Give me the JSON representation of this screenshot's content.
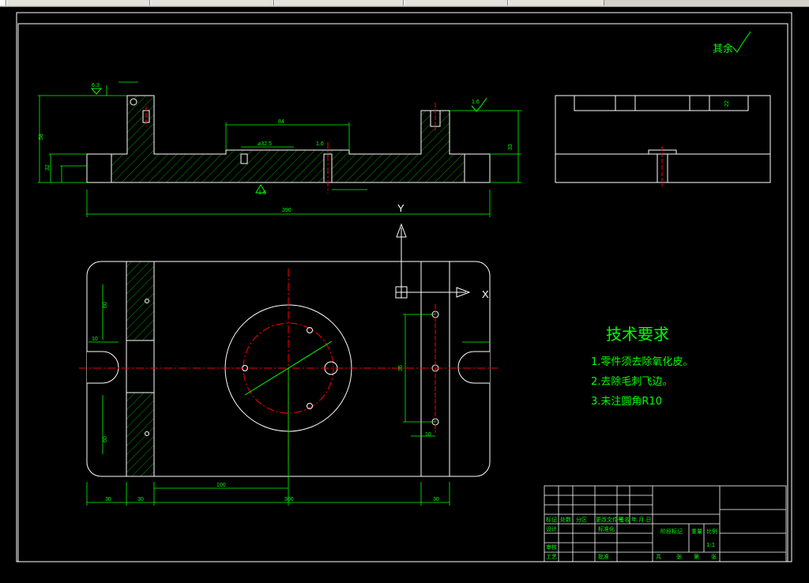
{
  "window": {
    "tabs": [
      "",
      "",
      "",
      "",
      "",
      ""
    ]
  },
  "drawing": {
    "surface_roughness_note": "其余",
    "tech_title": "技术要求",
    "tech_items": [
      "1.零件须去除氧化皮。",
      "2.去除毛刺飞边。",
      "3.未注圆角R10"
    ],
    "ucs": {
      "y_label": "Y",
      "x_label": "X"
    },
    "dims": {
      "overall_length": "390",
      "plan_length": "300",
      "plan_left": "30",
      "plan_left2": "30",
      "plan_right": "30",
      "hole_offset": "100",
      "top_span": "84",
      "top_hole": "⌀32.5",
      "height_total": "58",
      "height_mid": "32",
      "height_right": "33",
      "rough_a": "6.3",
      "rough_b": "1.6",
      "rough_c": "1.6",
      "rough_d": "1.6",
      "side_h": "22",
      "plan_v1": "60",
      "plan_v2": "60",
      "plan_r1": "10",
      "plan_r2": "10",
      "plan_r_dim": "36"
    },
    "title_block": {
      "labels": [
        "标记",
        "处数",
        "分区",
        "更改文件号",
        "签名",
        "年.月.日",
        "设计",
        "标准化",
        "阶段标记",
        "重量",
        "比例",
        "审核",
        "工艺",
        "批准",
        "共",
        "张",
        "第",
        "张",
        "1:1"
      ]
    },
    "colors": {
      "green": "#00ff00",
      "white": "#ffffff",
      "red": "#ff0000",
      "yellow": "#ffff00"
    }
  }
}
